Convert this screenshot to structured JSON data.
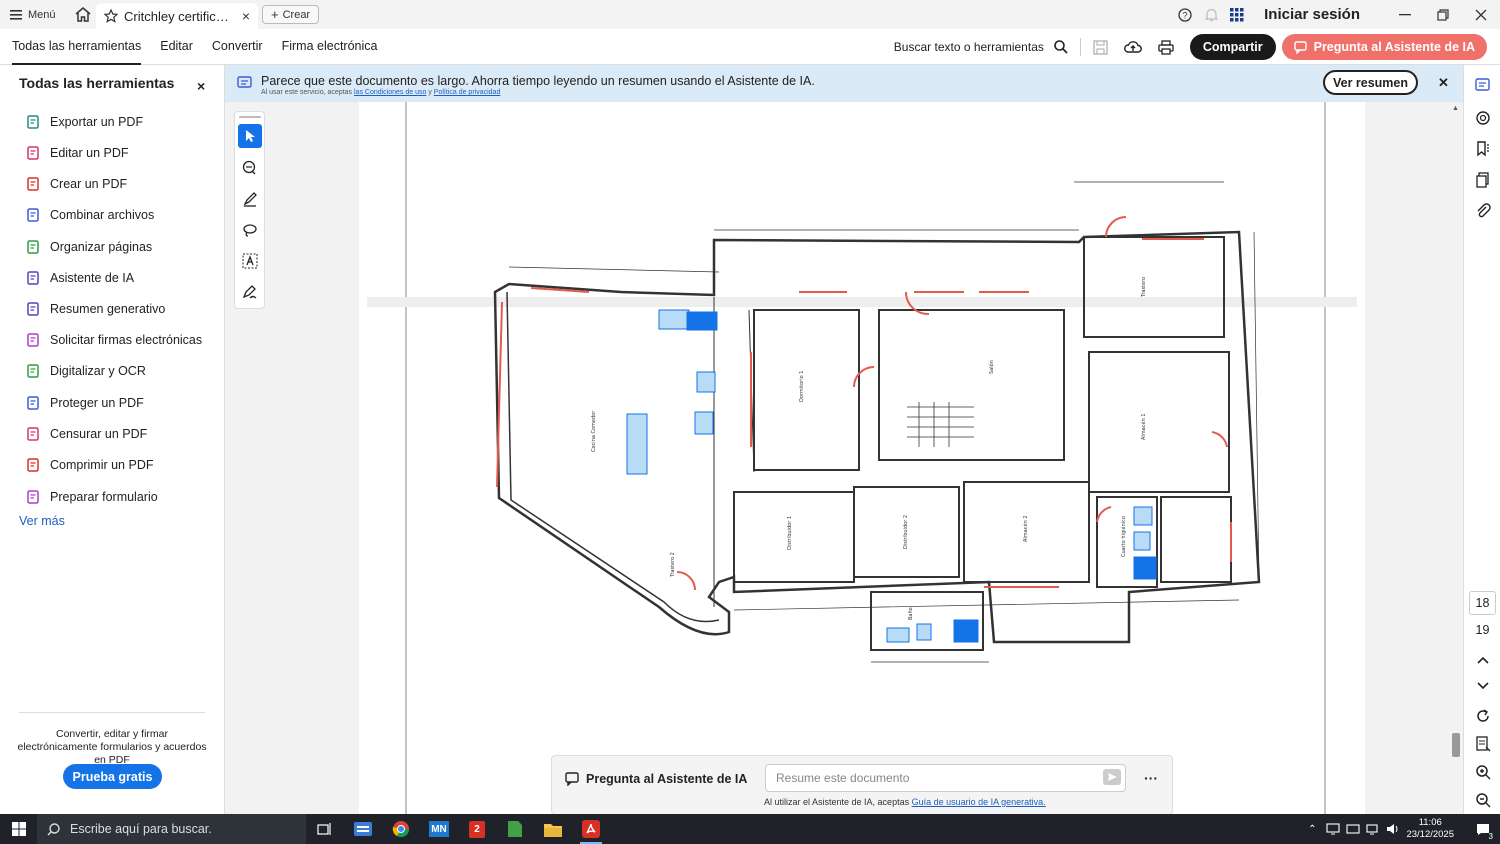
{
  "titlebar": {
    "menu_label": "Menú",
    "tab_title": "Critchley certificado ...",
    "crear_label": "Crear",
    "signin_label": "Iniciar sesión"
  },
  "toolbar": {
    "menus": [
      "Todas las herramientas",
      "Editar",
      "Convertir",
      "Firma electrónica"
    ],
    "search_label": "Buscar texto o herramientas",
    "share_label": "Compartir",
    "ask_label": "Pregunta al Asistente de IA"
  },
  "left_panel": {
    "title": "Todas las herramientas",
    "tools": [
      {
        "label": "Exportar un PDF",
        "icon": "export-pdf-icon",
        "color": "#1e8a87"
      },
      {
        "label": "Editar un PDF",
        "icon": "edit-pdf-icon",
        "color": "#d6336c"
      },
      {
        "label": "Crear un PDF",
        "icon": "create-pdf-icon",
        "color": "#d93025"
      },
      {
        "label": "Combinar archivos",
        "icon": "combine-files-icon",
        "color": "#3b5bdb"
      },
      {
        "label": "Organizar páginas",
        "icon": "organize-pages-icon",
        "color": "#2f9e44"
      },
      {
        "label": "Asistente de IA",
        "icon": "ai-assistant-icon",
        "color": "#5f3dc4"
      },
      {
        "label": "Resumen generativo",
        "icon": "generative-summary-icon",
        "color": "#5f3dc4"
      },
      {
        "label": "Solicitar firmas electrónicas",
        "icon": "request-signatures-icon",
        "color": "#ae3ec9"
      },
      {
        "label": "Digitalizar y OCR",
        "icon": "scan-ocr-icon",
        "color": "#2f9e44"
      },
      {
        "label": "Proteger un PDF",
        "icon": "protect-pdf-icon",
        "color": "#3b5bdb"
      },
      {
        "label": "Censurar un PDF",
        "icon": "redact-pdf-icon",
        "color": "#d6336c"
      },
      {
        "label": "Comprimir un PDF",
        "icon": "compress-pdf-icon",
        "color": "#d93025"
      },
      {
        "label": "Preparar formulario",
        "icon": "prepare-form-icon",
        "color": "#ae3ec9"
      }
    ],
    "see_more": "Ver más",
    "promo_text": "Convertir, editar y firmar electrónicamente formularios y acuerdos en PDF",
    "trial_label": "Prueba gratis"
  },
  "ai_banner": {
    "text": "Parece que este documento es largo. Ahorra tiempo leyendo un resumen usando el Asistente de IA.",
    "small_prefix": "Al usar este servicio, aceptas",
    "small_link1": "las Condiciones de uso",
    "small_and": "y",
    "small_link2": "Política de privacidad",
    "button_label": "Ver resumen"
  },
  "ai_bar": {
    "title": "Pregunta al Asistente de IA",
    "placeholder": "Resume este documento",
    "note_prefix": "Al utilizar el Asistente de IA, aceptas",
    "note_link": "Guía de usuario de IA generativa."
  },
  "floorplan": {
    "rooms": [
      "Cocina Comedor",
      "Dormitorio 1",
      "Salón",
      "Trastero",
      "Almacén 1",
      "Distribuidor 1",
      "Distribuidor 2",
      "Almacén 2",
      "Cuarto higiénico",
      "Baño",
      "Trastero 2"
    ]
  },
  "pages": {
    "current": "18",
    "next": "19"
  },
  "taskbar": {
    "search_placeholder": "Escribe aquí para buscar.",
    "time": "11:06",
    "date": "23/12/2025",
    "notif_count": "3"
  }
}
